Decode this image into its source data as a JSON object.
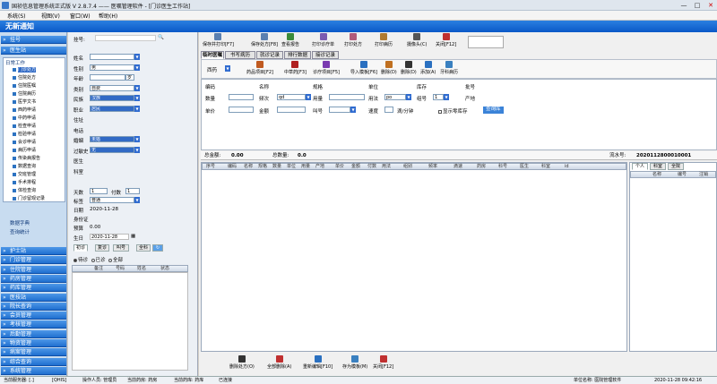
{
  "window": {
    "title": "国祯信息管理系统正式版 V 2.8.7.4 —— 医嘱管理软件 - [门诊医生工作站]",
    "controls": [
      "—",
      "□",
      "✕"
    ]
  },
  "menu": [
    "系统(S)",
    "视图(V)",
    "窗口(W)",
    "帮助(H)"
  ],
  "notice": "无新通知",
  "nav": {
    "top": [
      "挂号",
      "医生站"
    ],
    "tree_root": "日常工作",
    "tree_items": [
      "门诊处方",
      "住院处方",
      "住院医嘱",
      "住院病历",
      "医学文书",
      "西药申请",
      "中药申请",
      "检查申请",
      "检验申请",
      "会诊申请",
      "病历申请",
      "传染病报告",
      "数据查询",
      "交班管理",
      "手术排程",
      "体检查询",
      "门诊留观记录"
    ],
    "collapsed": [
      "数据字典",
      "查询统计"
    ],
    "bottom": [
      "护士站",
      "门诊管理",
      "住院管理",
      "药房管理",
      "药库管理",
      "医技站",
      "院长查询",
      "会员管理",
      "考核管理",
      "后勤管理",
      "物资管理",
      "病案管理",
      "综合查询",
      "系统管理"
    ]
  },
  "patient": {
    "search_label": "挂号:",
    "fields": [
      {
        "label": "姓名",
        "value": ""
      },
      {
        "label": "性别",
        "value": "男"
      },
      {
        "label": "年龄",
        "value": "",
        "unit": "岁"
      },
      {
        "label": "类别",
        "value": "自费"
      },
      {
        "label": "民族",
        "value": "汉族"
      },
      {
        "label": "职业",
        "value": "居民"
      },
      {
        "label": "住址",
        "value": ""
      },
      {
        "label": "电话",
        "value": ""
      },
      {
        "label": "婚姻",
        "value": "未婚"
      },
      {
        "label": "过敏史",
        "value": "无"
      },
      {
        "label": "医生",
        "value": ""
      },
      {
        "label": "科室",
        "value": ""
      }
    ],
    "tianshu_label": "天数",
    "tianshu_value": "1",
    "fushu_label": "付数",
    "fushu_value": "1",
    "zhuangtai_label": "标签",
    "zhuangtai_value": "普通",
    "date_label": "日期",
    "date_value": "2020-11-28",
    "id_label": "身份证",
    "id_value": "",
    "prepay_label": "预算",
    "prepay_value": "0.00",
    "birth_label": "生日",
    "birth_value": "2020-11-28",
    "tabs": [
      "初诊",
      "复诊",
      "叫号",
      "全科"
    ],
    "radios": [
      "待诊",
      "已诊",
      "全部"
    ],
    "list_headers": [
      "备注",
      "号码",
      "姓名",
      "状态"
    ]
  },
  "toolbar": [
    "保存并打印[F7]",
    "保存处方[F8]",
    "查看报告",
    "打印诊疗单",
    "打印处方",
    "打印病历",
    "摄像头(C)",
    "关闭[F12]"
  ],
  "tabs": [
    "临时医嘱",
    "书写病历",
    "就诊记录",
    "排行数据",
    "接诊记录"
  ],
  "subtoolbar": {
    "dept": "西药",
    "buttons": [
      "药品项目[F2]",
      "中草药[F3]",
      "诊疗项目[F5]",
      "导入模板[F6]",
      "删除(D)",
      "删除(D)",
      "添加(A)",
      "牙科病历"
    ]
  },
  "form": {
    "row1": [
      "编码",
      "名称",
      "规格",
      "单位",
      "库存",
      "批号"
    ],
    "row2": {
      "qty": "数量",
      "freq_label": "频次",
      "freq_val": "qd",
      "dose": "用量",
      "usage_label": "用法",
      "usage_val": "po",
      "group": "组号",
      "producer": "产地",
      "group_val": "1"
    },
    "row3": {
      "price": "单价",
      "amount": "金额",
      "num": "叫号",
      "speed": "速度",
      "speed_unit": "滴/分钟",
      "check": "显示零库存",
      "btn": "查询库"
    }
  },
  "summary": {
    "total_label": "总金额:",
    "total": "0.00",
    "qty_label": "总数量:",
    "qty": "0.0",
    "serial_label": "流水号:",
    "serial": "2020112800010001"
  },
  "grid_headers": [
    "序号",
    "编码",
    "名称",
    "规格",
    "数量",
    "单位",
    "用量",
    "产地",
    "单价",
    "金额",
    "付数",
    "用法",
    "组别",
    "频率",
    "滴速",
    "药房",
    "科号",
    "医生",
    "科室",
    "id"
  ],
  "right_tabs": [
    "个人",
    "科室",
    "全院"
  ],
  "right_headers": [
    "名称",
    "编号",
    "注销"
  ],
  "bottom_buttons": [
    "删除处方(O)",
    "全部删除(A)",
    "重新编辑[F10]",
    "存为模板(M)",
    "关闭[F12]"
  ],
  "status": {
    "s1": "当前服务器: [.]",
    "s2": "[QHIS]",
    "s3": "操作人员: 管理员",
    "s4": "当前药房: 药房",
    "s5": "当前药库: 药库",
    "s6": "已连接",
    "unit": "单位名称: 医院管理软件",
    "time": "2020-11-28 09:42:16"
  },
  "colors": {
    "accent": "#1f6fcf",
    "nav_bg": "#c8dcf0",
    "select": "#316ac5"
  }
}
